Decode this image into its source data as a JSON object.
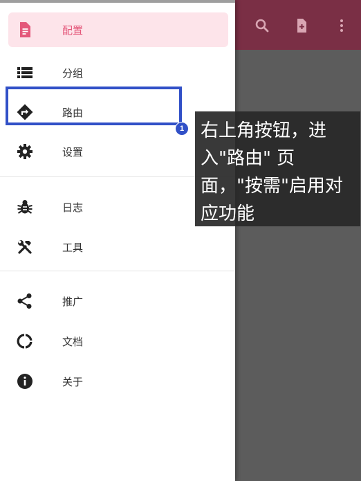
{
  "drawer": {
    "items": [
      {
        "label": "配置",
        "icon": "file-document-icon",
        "active": true
      },
      {
        "label": "分组",
        "icon": "list-icon"
      },
      {
        "label": "路由",
        "icon": "directions-sign-icon"
      },
      {
        "label": "设置",
        "icon": "gear-icon"
      },
      {
        "label": "日志",
        "icon": "bug-icon"
      },
      {
        "label": "工具",
        "icon": "tools-icon"
      },
      {
        "label": "推广",
        "icon": "share-icon"
      },
      {
        "label": "文档",
        "icon": "donut-icon"
      },
      {
        "label": "关于",
        "icon": "info-icon"
      }
    ]
  },
  "appbar": {
    "actions": [
      "search-icon",
      "add-file-icon",
      "more-vert-icon"
    ],
    "color": "#7a2f45"
  },
  "tutorial": {
    "step": "1",
    "text": "右上角按钮，进入\"路由\" 页面，\"按需\"启用对应功能"
  },
  "colors": {
    "accent": "#e4577a",
    "active_bg": "#fde4ea",
    "highlight": "#3150c7"
  }
}
